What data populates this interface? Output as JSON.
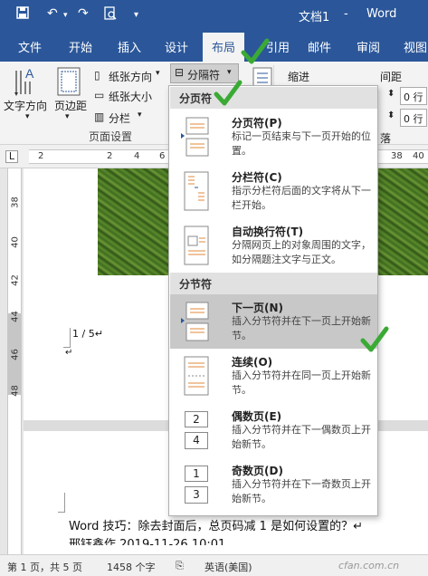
{
  "window": {
    "doc_title": "文档1",
    "separator": "-",
    "app_name": "Word"
  },
  "tabs": [
    "文件",
    "开始",
    "插入",
    "设计",
    "布局",
    "引用",
    "邮件",
    "审阅",
    "视图"
  ],
  "active_tab": "布局",
  "ribbon": {
    "text_direction": "文字方向",
    "margins": "页边距",
    "orientation": "纸张方向",
    "size": "纸张大小",
    "columns": "分栏",
    "breaks": "分隔符",
    "page_setup_label": "页面设置",
    "indent": "缩进",
    "spacing": "间距",
    "spin1": "0 行",
    "spin2": "0 行",
    "right_label": "落"
  },
  "ruler": {
    "ticks": [
      "2",
      "2",
      "4",
      "6",
      "8",
      "34",
      "36",
      "38",
      "40"
    ]
  },
  "vruler": {
    "ticks": [
      "38",
      "40",
      "42",
      "44",
      "46",
      "48"
    ]
  },
  "document": {
    "page_num": "1 / 5↵",
    "return_mark": "↵",
    "line1": "Word 技巧：除去封面后，总页码减 1 是如何设置的？↵",
    "line2": "邢钰鑫作 2019-11-26 10:01"
  },
  "dropdown": {
    "section1": "分页符",
    "section2": "分节符",
    "items": [
      {
        "title": "分页符(P)",
        "desc": "标记一页结束与下一页开始的位置。"
      },
      {
        "title": "分栏符(C)",
        "desc": "指示分栏符后面的文字将从下一栏开始。"
      },
      {
        "title": "自动换行符(T)",
        "desc": "分隔网页上的对象周围的文字，如分隔题注文字与正文。"
      },
      {
        "title": "下一页(N)",
        "desc": "插入分节符并在下一页上开始新节。"
      },
      {
        "title": "连续(O)",
        "desc": "插入分节符并在同一页上开始新节。"
      },
      {
        "title": "偶数页(E)",
        "desc": "插入分节符并在下一偶数页上开始新节。"
      },
      {
        "title": "奇数页(D)",
        "desc": "插入分节符并在下一奇数页上开始新节。"
      }
    ],
    "even_icon_nums": [
      "2",
      "4"
    ],
    "odd_icon_nums": [
      "1",
      "3"
    ]
  },
  "status": {
    "page": "第 1 页，共 5 页",
    "words": "1458 个字",
    "language": "英语(美国)"
  },
  "watermark": "cfan.com.cn",
  "colors": {
    "accent": "#2b579a",
    "check": "#3aaa35"
  }
}
